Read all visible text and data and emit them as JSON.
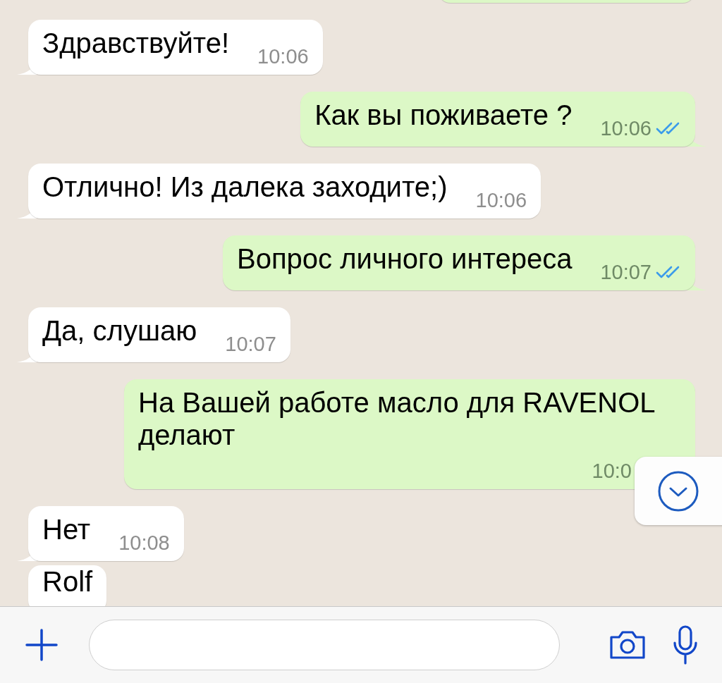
{
  "messages": [
    {
      "kind": "outgoing",
      "clipped": true
    },
    {
      "kind": "incoming",
      "text": "Здравствуйте!",
      "time": "10:06"
    },
    {
      "kind": "outgoing",
      "text": "Как вы поживаете ?",
      "time": "10:06",
      "read": true
    },
    {
      "kind": "incoming",
      "text": "Отлично! Из далека заходите;)",
      "time": "10:06"
    },
    {
      "kind": "outgoing",
      "text": "Вопрос личного интереса",
      "time": "10:07",
      "read": true
    },
    {
      "kind": "incoming",
      "text": "Да, слушаю",
      "time": "10:07"
    },
    {
      "kind": "outgoing",
      "text": "На Вашей работе масло для RAVENOL делают",
      "time": "10:0"
    },
    {
      "kind": "incoming",
      "text": "Нет",
      "time": "10:08"
    },
    {
      "kind": "incoming",
      "text": "Rolf"
    }
  ]
}
